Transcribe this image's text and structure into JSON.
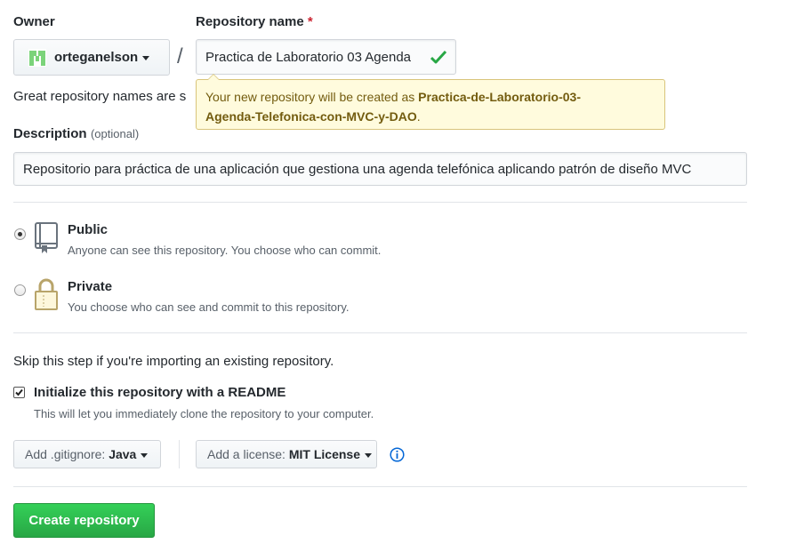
{
  "owner": {
    "label": "Owner",
    "username": "orteganelson"
  },
  "separator": "/",
  "repo_name": {
    "label": "Repository name",
    "required_mark": "*",
    "value": "Practica de Laboratorio 03 Agenda"
  },
  "hint": {
    "partial_text": "Great repository names are s",
    "tooltip_prefix": "Your new repository will be created as ",
    "tooltip_name_line1": "Practica-de-Laboratorio-03-",
    "tooltip_name_line2": "Agenda-Telefonica-con-MVC-y-DAO",
    "tooltip_suffix": "."
  },
  "description": {
    "label": "Description",
    "optional": "(optional)",
    "value": "Repositorio para práctica de una aplicación que gestiona una agenda telefónica aplicando patrón de diseño MVC"
  },
  "visibility": {
    "selected": "public",
    "options": [
      {
        "title": "Public",
        "desc": "Anyone can see this repository. You choose who can commit."
      },
      {
        "title": "Private",
        "desc": "You choose who can see and commit to this repository."
      }
    ]
  },
  "skip_text": "Skip this step if you're importing an existing repository.",
  "readme": {
    "checked": true,
    "label": "Initialize this repository with a README",
    "desc": "This will let you immediately clone the repository to your computer."
  },
  "gitignore": {
    "prefix": "Add .gitignore:",
    "value": "Java"
  },
  "license": {
    "prefix": "Add a license:",
    "value": "MIT License"
  },
  "submit_label": "Create repository",
  "colors": {
    "primary": "#2cbe4e",
    "success_check": "#28a745",
    "tooltip_bg": "#fffbdd",
    "info_icon": "#0366d6",
    "required": "#cb2431"
  }
}
